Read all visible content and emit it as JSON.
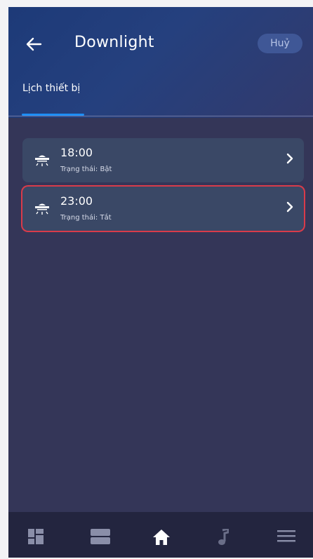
{
  "header": {
    "title": "Downlight",
    "cancel_label": "Huỷ",
    "back_icon": "arrow-left-icon"
  },
  "tabs": [
    {
      "label": "Lịch thiết bị",
      "active": true
    }
  ],
  "schedules": [
    {
      "time": "18:00",
      "status": "Trạng thái: Bật",
      "icon": "downlight-icon"
    },
    {
      "time": "23:00",
      "status": "Trạng thái: Tắt",
      "icon": "downlight-icon",
      "highlighted": true
    }
  ],
  "bottom_nav": [
    {
      "icon": "dashboard-icon"
    },
    {
      "icon": "rooms-icon"
    },
    {
      "icon": "home-icon",
      "active": true
    },
    {
      "icon": "music-icon"
    },
    {
      "icon": "menu-icon"
    }
  ],
  "colors": {
    "accent": "#1d8ef6",
    "background": "#343658",
    "card": "#3a4866",
    "highlight_border": "#d93b4a",
    "bottom_bar": "#23253f"
  }
}
